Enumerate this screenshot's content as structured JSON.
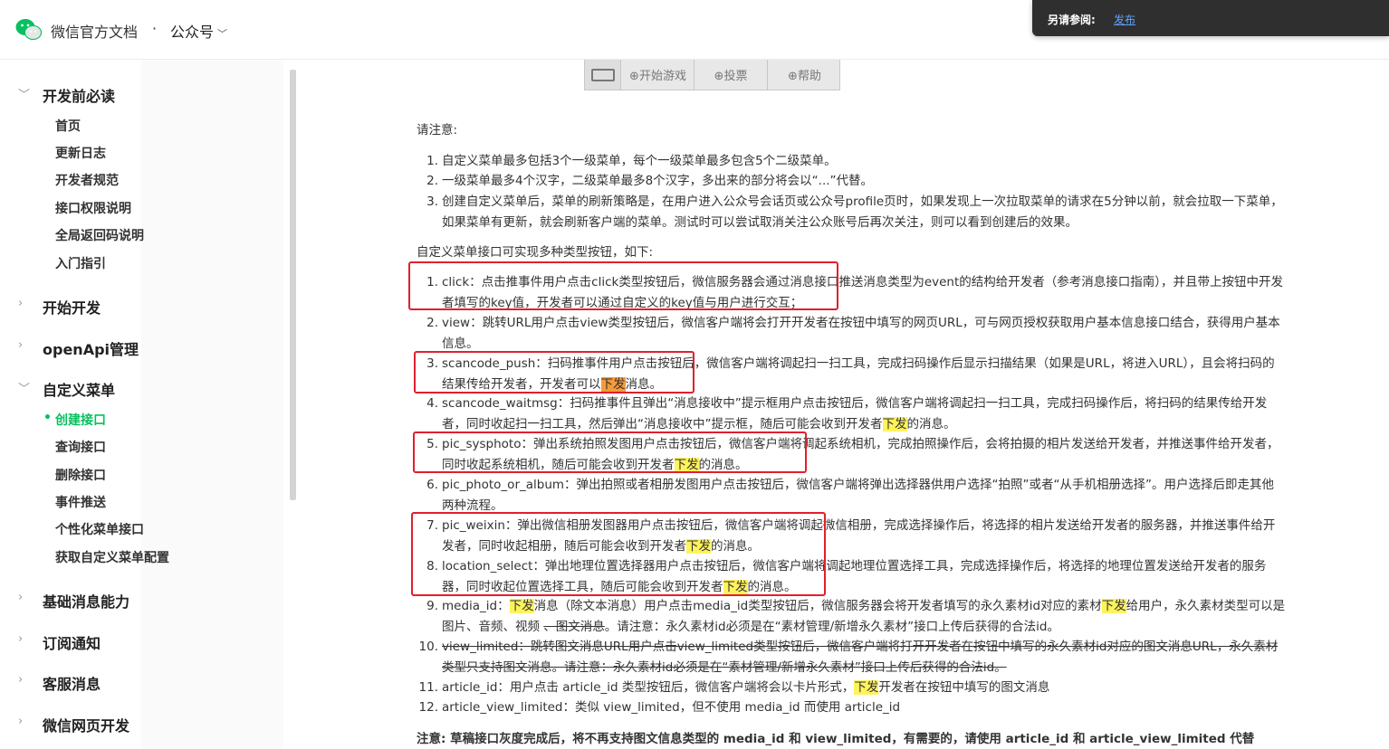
{
  "header": {
    "brand": "微信官方文档",
    "separator": "·",
    "section": "公众号",
    "popover_label": "另请参阅:",
    "popover_link": "发布"
  },
  "sidebar": {
    "groups": [
      {
        "label": "开发前必读",
        "expanded": true,
        "items": [
          "首页",
          "更新日志",
          "开发者规范",
          "接口权限说明",
          "全局返回码说明",
          "入门指引"
        ]
      },
      {
        "label": "开始开发",
        "expanded": false
      },
      {
        "label": "openApi管理",
        "expanded": false
      },
      {
        "label": "自定义菜单",
        "expanded": true,
        "items": [
          "创建接口",
          "查询接口",
          "删除接口",
          "事件推送",
          "个性化菜单接口",
          "获取自定义菜单配置"
        ],
        "active": "创建接口"
      },
      {
        "label": "基础消息能力",
        "expanded": false
      },
      {
        "label": "订阅通知",
        "expanded": false
      },
      {
        "label": "客服消息",
        "expanded": false
      },
      {
        "label": "微信网页开发",
        "expanded": false
      }
    ]
  },
  "menu_image": {
    "buttons": [
      "⊕开始游戏",
      "⊕投票",
      "⊕帮助"
    ]
  },
  "main": {
    "notice_title": "请注意:",
    "notice_items": [
      "自定义菜单最多包括3个一级菜单，每个一级菜单最多包含5个二级菜单。",
      "一级菜单最多4个汉字，二级菜单最多8个汉字，多出来的部分将会以“...”代替。",
      "创建自定义菜单后，菜单的刷新策略是，在用户进入公众号会话页或公众号profile页时，如果发现上一次拉取菜单的请求在5分钟以前，就会拉取一下菜单，如果菜单有更新，就会刷新客户端的菜单。测试时可以尝试取消关注公众账号后再次关注，则可以看到创建后的效果。"
    ],
    "types_title": "自定义菜单接口可实现多种类型按钮，如下:",
    "types": {
      "t1": "click：点击推事件用户点击click类型按钮后，微信服务器会通过消息接口推送消息类型为event的结构给开发者（参考消息接口指南），并且带上按钮中开发者填写的key值，开发者可以通过自定义的key值与用户进行交互；",
      "t2": "view：跳转URL用户点击view类型按钮后，微信客户端将会打开开发者在按钮中填写的网页URL，可与网页授权获取用户基本信息接口结合，获得用户基本信息。",
      "t3a": "scancode_push：扫码推事件用户点击按钮后，微信客户端将调起扫一扫工具，完成扫码操作后显示扫描结果（如果是URL，将进入URL），且会将扫码的结果传给开发者，开发者可以",
      "t3hl": "下发",
      "t3b": "消息。",
      "t4a": "scancode_waitmsg：扫码推事件且弹出“消息接收中”提示框用户点击按钮后，微信客户端将调起扫一扫工具，完成扫码操作后，将扫码的结果传给开发者，同时收起扫一扫工具，然后弹出“消息接收中”提示框，随后可能会收到开发者",
      "t4hl": "下发",
      "t4b": "的消息。",
      "t5a": "pic_sysphoto：弹出系统拍照发图用户点击按钮后，微信客户端将调起系统相机，完成拍照操作后，会将拍摄的相片发送给开发者，并推送事件给开发者，同时收起系统相机，随后可能会收到开发者",
      "t5hl": "下发",
      "t5b": "的消息。",
      "t6": "pic_photo_or_album：弹出拍照或者相册发图用户点击按钮后，微信客户端将弹出选择器供用户选择“拍照”或者“从手机相册选择”。用户选择后即走其他两种流程。",
      "t7a": "pic_weixin：弹出微信相册发图器用户点击按钮后，微信客户端将调起微信相册，完成选择操作后，将选择的相片发送给开发者的服务器，并推送事件给开发者，同时收起相册，随后可能会收到开发者",
      "t7hl": "下发",
      "t7b": "的消息。",
      "t8a": "location_select：弹出地理位置选择器用户点击按钮后，微信客户端将调起地理位置选择工具，完成选择操作后，将选择的地理位置发送给开发者的服务器，同时收起位置选择工具，随后可能会收到开发者",
      "t8hl": "下发",
      "t8b": "的消息。",
      "t9a": "media_id：",
      "t9hl1": "下发",
      "t9b": "消息（除文本消息）用户点击media_id类型按钮后，微信服务器会将开发者填写的永久素材id对应的素材",
      "t9hl2": "下发",
      "t9c": "给用户，永久素材类型可以是图片、音频、视频 ",
      "t9s": "、图文消息",
      "t9d": "。请注意：永久素材id必须是在“素材管理/新增永久素材”接口上传后获得的合法id。",
      "t10": "view_limited：跳转图文消息URL用户点击view_limited类型按钮后，微信客户端将打开开发者在按钮中填写的永久素材id对应的图文消息URL，永久素材类型只支持图文消息。请注意：永久素材id必须是在“素材管理/新增永久素材”接口上传后获得的合法id。",
      "t11a": "article_id：用户点击 article_id 类型按钮后，微信客户端将会以卡片形式，",
      "t11hl": "下发",
      "t11b": "开发者在按钮中填写的图文消息",
      "t12": "article_view_limited：类似 view_limited，但不使用 media_id 而使用 article_id"
    },
    "footnote": "注意: 草稿接口灰度完成后，将不再支持图文信息类型的 media_id 和 view_limited，有需要的，请使用 article_id 和 article_view_limited 代替"
  },
  "colors": {
    "accent": "#07c160",
    "highlight": "#fff35c",
    "highlight_orange": "#f59a3a",
    "annotation_box": "#e0202c"
  }
}
